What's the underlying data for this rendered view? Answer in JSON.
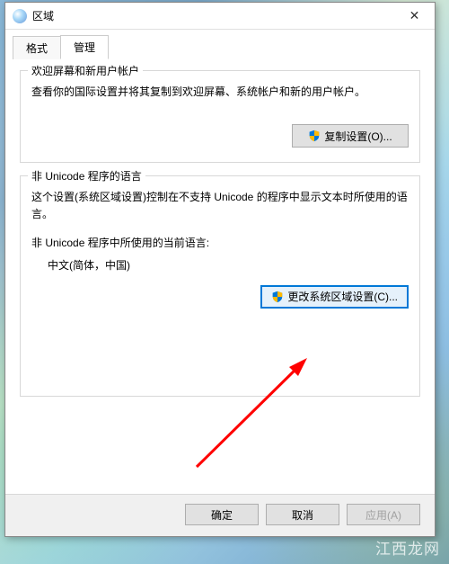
{
  "dialog": {
    "title": "区域",
    "tabs": {
      "format": "格式",
      "admin": "管理"
    },
    "group1": {
      "title": "欢迎屏幕和新用户帐户",
      "text": "查看你的国际设置并将其复制到欢迎屏幕、系统帐户和新的用户帐户。",
      "button": "复制设置(O)..."
    },
    "group2": {
      "title": "非 Unicode 程序的语言",
      "text": "这个设置(系统区域设置)控制在不支持 Unicode 的程序中显示文本时所使用的语言。",
      "current_label": "非 Unicode 程序中所使用的当前语言:",
      "current_value": "中文(简体，中国)",
      "button": "更改系统区域设置(C)..."
    },
    "buttons": {
      "ok": "确定",
      "cancel": "取消",
      "apply": "应用(A)"
    }
  },
  "watermark": "江西龙网"
}
